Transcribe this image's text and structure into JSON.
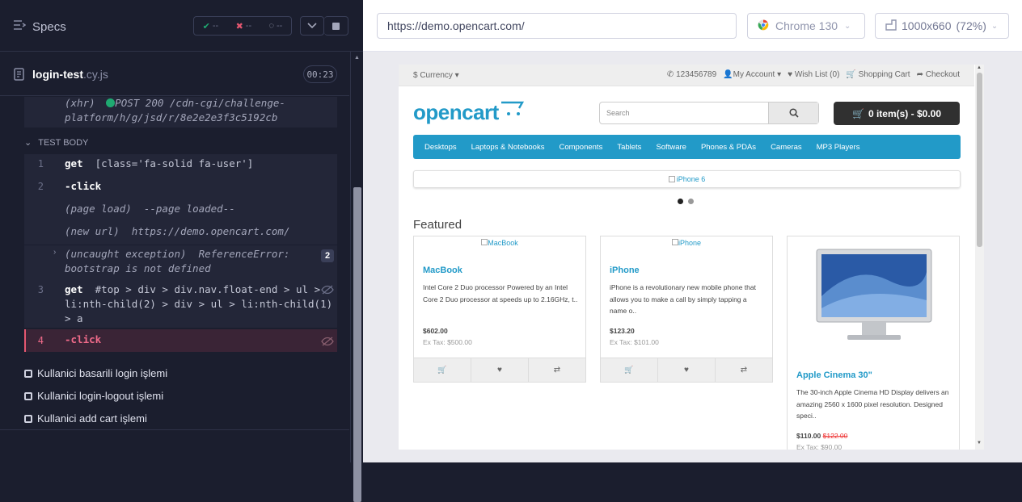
{
  "runner": {
    "specs_label": "Specs",
    "stats": {
      "passed": "--",
      "failed": "--",
      "pending": "--"
    },
    "file": {
      "name": "login-test",
      "ext": ".cy.js",
      "duration": "00:23"
    },
    "xhr_line1": "(xhr)",
    "xhr_line1b": "POST 200 /cdn-cgi/challenge-",
    "xhr_line2": "platform/h/g/jsd/r/8e2e2e3f3c5192cb",
    "section_label": "TEST BODY",
    "commands": [
      {
        "num": "1",
        "name": "get",
        "msg": "[class='fa-solid fa-user']"
      },
      {
        "num": "2",
        "name": "-click",
        "msg": ""
      },
      {
        "num": "",
        "name": "(page load)",
        "msg": "--page loaded--"
      },
      {
        "num": "",
        "name": "(new url)",
        "msg": "https://demo.opencart.com/"
      },
      {
        "num": "",
        "name": "(uncaught exception)",
        "msg": "ReferenceError:",
        "msg2": "bootstrap is not defined",
        "badge": "2"
      },
      {
        "num": "3",
        "name": "get",
        "msg": "#top > div > div.nav.float-end > ul >",
        "msg2": "li:nth-child(2) > div > ul > li:nth-child(1)",
        "msg3": "> a"
      },
      {
        "num": "4",
        "name": "-click",
        "msg": ""
      }
    ],
    "tests": [
      "Kullanici basarili login işlemi",
      "Kullanici login-logout işlemi",
      "Kullanici add cart işlemi"
    ]
  },
  "aut": {
    "url": "https://demo.opencart.com/",
    "browser": "Chrome 130",
    "viewport": "1000x660",
    "zoom": "(72%)"
  },
  "site": {
    "currency": "$ Currency",
    "phone": "123456789",
    "my_account": "My Account",
    "wishlist": "Wish List (0)",
    "shopping_cart": "Shopping Cart",
    "checkout": "Checkout",
    "logo": "opencart",
    "search_placeholder": "Search",
    "cart_button": "0 item(s) - $0.00",
    "menu": [
      "Desktops",
      "Laptops & Notebooks",
      "Components",
      "Tablets",
      "Software",
      "Phones & PDAs",
      "Cameras",
      "MP3 Players"
    ],
    "banner_alt": "iPhone 6",
    "featured_title": "Featured",
    "products": [
      {
        "img_alt": "MacBook",
        "name": "MacBook",
        "desc": "Intel Core 2 Duo processor Powered by an Intel Core 2 Duo processor at speeds up to 2.16GHz, t..",
        "price": "$602.00",
        "tax": "Ex Tax: $500.00"
      },
      {
        "img_alt": "iPhone",
        "name": "iPhone",
        "desc": "iPhone is a revolutionary new mobile phone that allows you to make a call by simply tapping a name o..",
        "price": "$123.20",
        "tax": "Ex Tax: $101.00"
      },
      {
        "img_alt": "",
        "name": "Apple Cinema 30\"",
        "desc": "The 30-inch Apple Cinema HD Display delivers an amazing 2560 x 1600 pixel resolution. Designed speci..",
        "price": "$110.00",
        "old_price": "$122.00",
        "tax": "Ex Tax: $90.00"
      }
    ]
  },
  "colors": {
    "accent": "#229ac8",
    "runner_bg": "#1b1e2e",
    "active_row": "#3a2436",
    "active_text": "#f06b8a"
  }
}
